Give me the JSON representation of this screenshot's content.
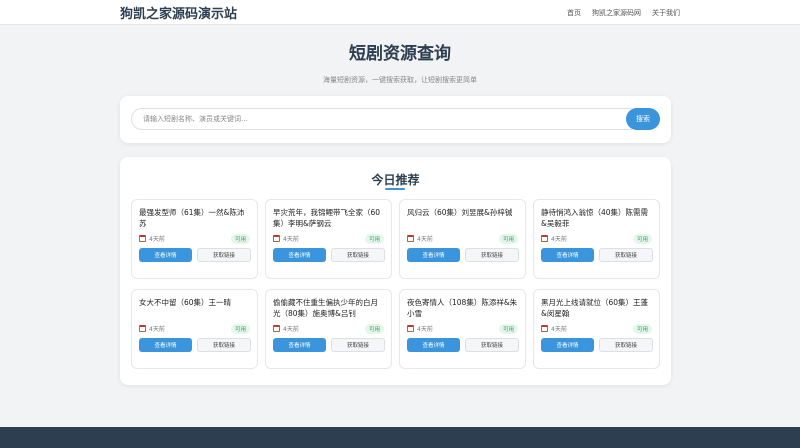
{
  "header": {
    "logo": "狗凯之家源码演示站",
    "nav": [
      "首页",
      "狗凯之家源码网",
      "关于我们"
    ]
  },
  "hero": {
    "title": "短剧资源查询",
    "subtitle": "海量短剧资源，一键搜索获取，让短剧搜索更简单"
  },
  "search": {
    "placeholder": "请输入短剧名称、演员或关键词...",
    "button": "搜索"
  },
  "recommend": {
    "title": "今日推荐",
    "items": [
      {
        "title": "最强发型师（61集）一然&陈沛苏",
        "date": "4天前",
        "badge": "可用",
        "detail": "查看详情",
        "get": "获取链接"
      },
      {
        "title": "早灾荒年，我锦鲤带飞全家（60集）李明&萨钢云",
        "date": "4天前",
        "badge": "可用",
        "detail": "查看详情",
        "get": "获取链接"
      },
      {
        "title": "风归云（60集）刘昱展&孙梓铖",
        "date": "4天前",
        "badge": "可用",
        "detail": "查看详情",
        "get": "获取链接"
      },
      {
        "title": "静待悄鸿入翁惊（40集）陈需需&吴毅菲",
        "date": "4天前",
        "badge": "可用",
        "detail": "查看详情",
        "get": "获取链接"
      },
      {
        "title": "女大不中留（60集）王一晴",
        "date": "4天前",
        "badge": "可用",
        "detail": "查看详情",
        "get": "获取链接"
      },
      {
        "title": "偷偷藏不住重生偏执少年的白月光（80集）施奥博&吕钊",
        "date": "4天前",
        "badge": "可用",
        "detail": "查看详情",
        "get": "获取链接"
      },
      {
        "title": "夜色寄情人（108集）陈添祥&朱小雪",
        "date": "4天前",
        "badge": "可用",
        "detail": "查看详情",
        "get": "获取链接"
      },
      {
        "title": "黑月光上线请就位（60集）王蓬&闵星翰",
        "date": "4天前",
        "badge": "可用",
        "detail": "查看详情",
        "get": "获取链接"
      }
    ]
  }
}
